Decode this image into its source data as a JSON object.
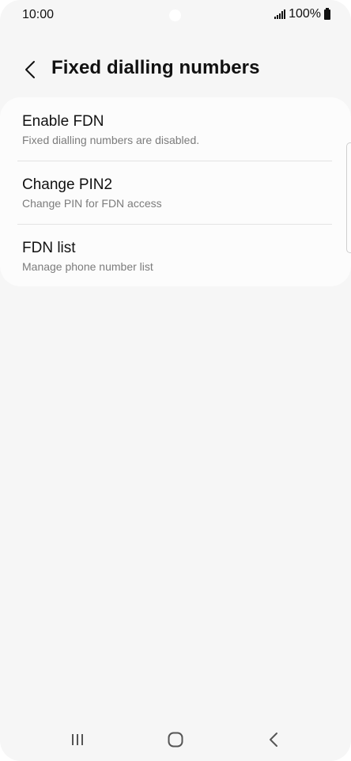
{
  "status_bar": {
    "time": "10:00",
    "battery_text": "100%",
    "icons": [
      "signal-icon",
      "battery-icon"
    ]
  },
  "header": {
    "back_icon": "chevron-left-icon",
    "title": "Fixed dialling numbers"
  },
  "items": [
    {
      "title": "Enable FDN",
      "subtitle": "Fixed dialling numbers are disabled."
    },
    {
      "title": "Change PIN2",
      "subtitle": "Change PIN for FDN access"
    },
    {
      "title": "FDN list",
      "subtitle": "Manage phone number list"
    }
  ],
  "nav_bar": {
    "recents_icon": "recents-icon",
    "home_icon": "home-icon",
    "back_icon": "back-icon"
  },
  "colors": {
    "background": "#f6f6f6",
    "card": "#fcfcfc",
    "title_text": "#111111",
    "subtitle_text": "#7c7c7c"
  }
}
